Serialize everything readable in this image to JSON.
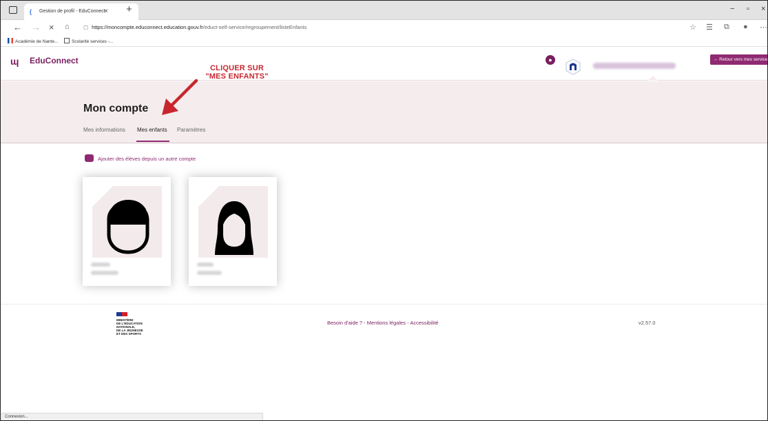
{
  "browser": {
    "tab_title": "Gestion de profil - EduConnect",
    "tab_close": "×",
    "new_tab": "+",
    "url_host": "https://moncompte.educonnect.education.gouv.fr",
    "url_path": "/educt-self-service/regroupement/listeEnfants",
    "bookmarks": [
      "Académie de Nante...",
      "Scolarité services -..."
    ],
    "status_text": "Connexion..."
  },
  "header": {
    "brand": "EduConnect",
    "back_button": "← Retour vers mes services"
  },
  "account": {
    "title": "Mon compte",
    "tabs": [
      "Mes informations",
      "Mes enfants",
      "Paramètres"
    ],
    "active_tab": "Mes enfants",
    "add_students": "Ajouter des élèves depuis un autre compte"
  },
  "annotation": {
    "line1": "CLIQUER SUR",
    "line2": "\"MES ENFANTS\""
  },
  "footer": {
    "ministry_lines": [
      "MINISTÈRE",
      "DE L'ÉDUCATION",
      "NATIONALE,",
      "DE LA JEUNESSE",
      "ET DES SPORTS"
    ],
    "links": [
      "Besoin d'aide ?",
      "Mentions légales",
      "Accessibilité"
    ],
    "version": "v2.57.0"
  },
  "colors": {
    "brand": "#7a1e5f",
    "accent": "#8f2a72",
    "band": "#f5eded",
    "annotation": "#c8262e"
  }
}
